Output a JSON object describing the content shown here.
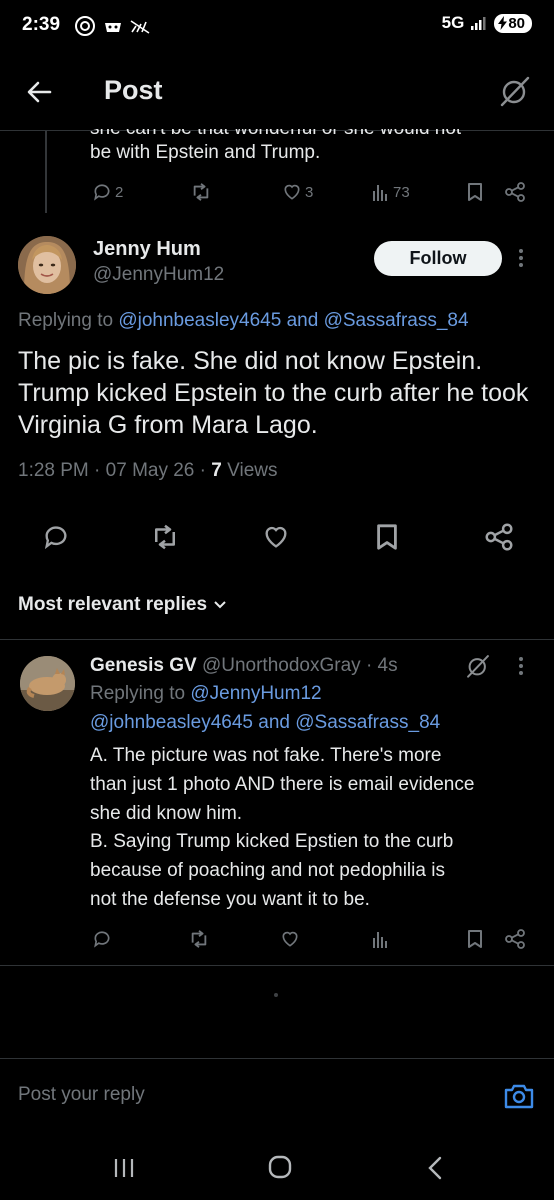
{
  "status_bar": {
    "time": "2:39",
    "network": "5G",
    "battery": "80"
  },
  "header": {
    "title": "Post",
    "back_icon": "arrow-left-icon",
    "grok_icon": "grok-icon"
  },
  "prior_post": {
    "text_cut": "she can't be that wonderful or she would not",
    "text_line2": "be with Epstein and Trump.",
    "replies": "2",
    "reposts": "",
    "likes": "3",
    "views": "73"
  },
  "main_post": {
    "author_name": "Jenny Hum",
    "author_handle": "@JennyHum12",
    "follow_label": "Follow",
    "replying_prefix": "Replying to",
    "replying_users": [
      "@johnbeasley4645",
      "@Sassafrass_84"
    ],
    "replying_and": "and",
    "body": "The pic is fake. She did not know Epstein. Trump kicked Epstein to the curb after he took Virginia G from Mara Lago.",
    "time": "1:28 PM",
    "date": "07 May 26",
    "views_count": "7",
    "views_label": "Views"
  },
  "sort": {
    "label": "Most relevant replies"
  },
  "reply": {
    "author_name": "Genesis GV",
    "author_handle": "@UnorthodoxGray",
    "time_ago": "4s",
    "replying_prefix": "Replying to",
    "replying_user1": "@JennyHum12",
    "replying_user2": "@johnbeasley4645",
    "replying_and": "and",
    "replying_user3": "@Sassafrass_84",
    "body_lines": [
      "A. The picture was not fake. There's more",
      "than just 1 photo AND there is email evidence",
      "she did know him.",
      "B. Saying Trump kicked Epstien to the curb",
      "because of poaching and not pedophilia is",
      "not the defense you want it to be."
    ]
  },
  "compose": {
    "placeholder": "Post your reply"
  },
  "colors": {
    "background": "#000000",
    "text": "#e7e9ea",
    "muted": "#71767b",
    "link": "#6a9be0",
    "divider": "#2f3336"
  }
}
